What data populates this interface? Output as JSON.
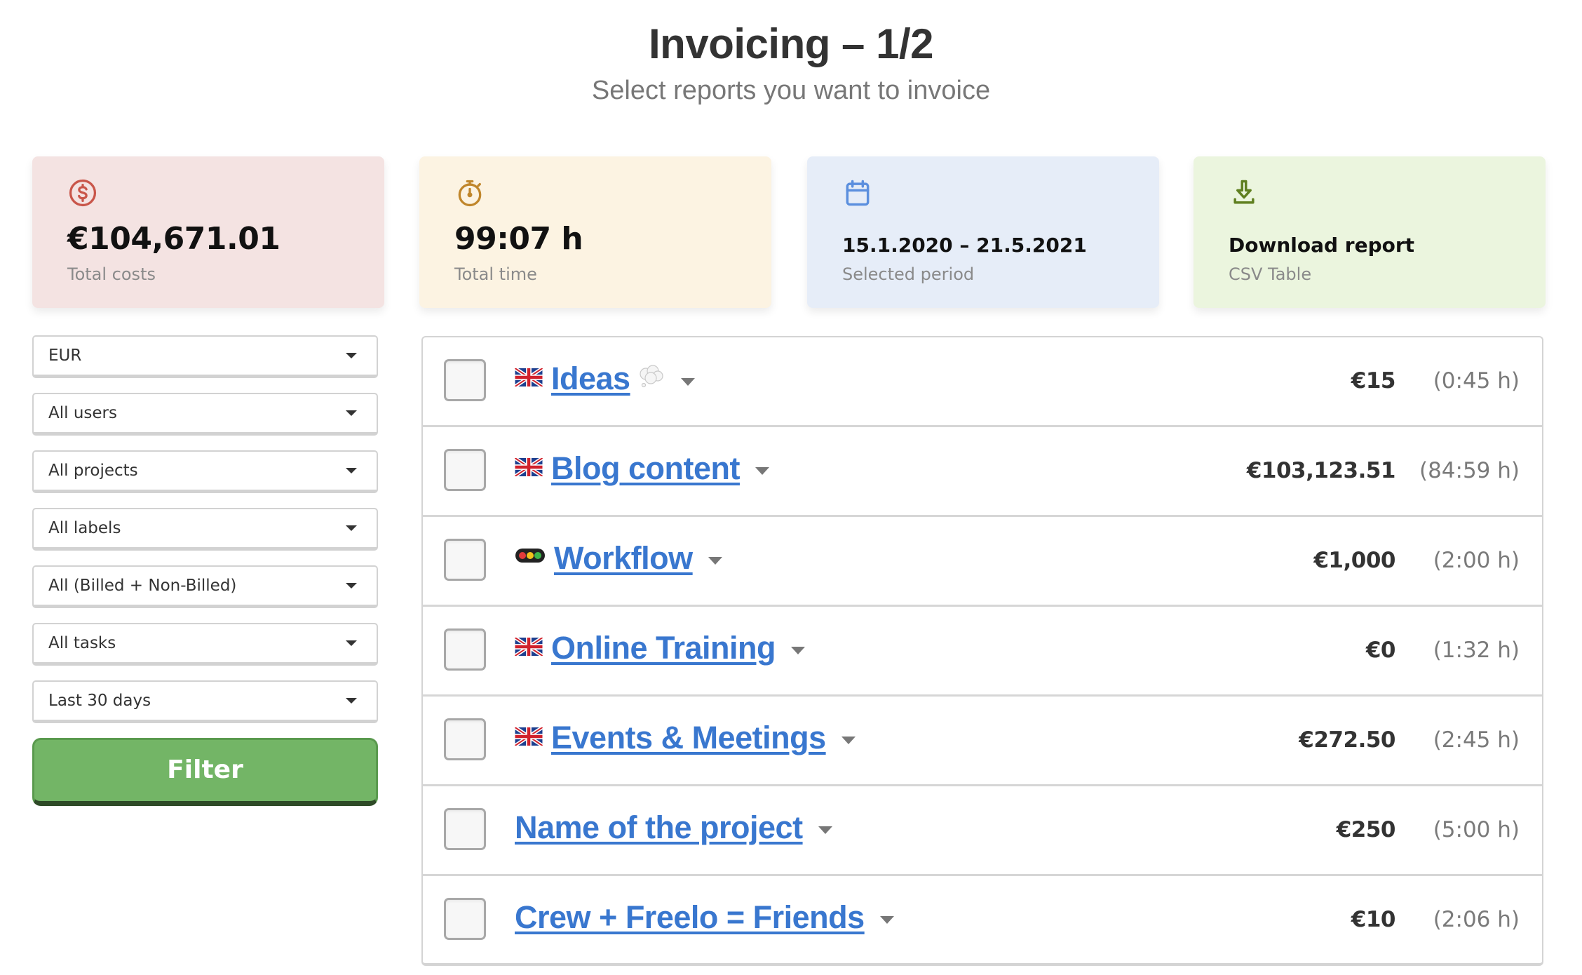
{
  "header": {
    "title": "Invoicing – 1/2",
    "subtitle": "Select reports you want to invoice"
  },
  "summary": {
    "costs": {
      "icon": "dollar-circle-icon",
      "value": "€104,671.01",
      "label": "Total costs",
      "color": "#c9564a",
      "background": "#f4e3e2"
    },
    "time": {
      "icon": "stopwatch-icon",
      "value": "99:07 h",
      "label": "Total time",
      "color": "#c0862b",
      "background": "#fcf3e2"
    },
    "period": {
      "icon": "calendar-icon",
      "value": "15.1.2020 – 21.5.2021",
      "label": "Selected period",
      "color": "#5b8fde",
      "background": "#e6edf8"
    },
    "download": {
      "icon": "download-icon",
      "value": "Download report",
      "label": "CSV Table",
      "color": "#5f7f1f",
      "background": "#ebf5de"
    }
  },
  "filters": {
    "selects": [
      {
        "name": "currency",
        "value": "EUR"
      },
      {
        "name": "users",
        "value": "All users"
      },
      {
        "name": "projects",
        "value": "All projects"
      },
      {
        "name": "labels",
        "value": "All labels"
      },
      {
        "name": "billing",
        "value": "All (Billed + Non-Billed)"
      },
      {
        "name": "tasks",
        "value": "All tasks"
      },
      {
        "name": "period",
        "value": "Last 30 days"
      }
    ],
    "button_label": "Filter",
    "button_color": "#73b566"
  },
  "reports": [
    {
      "prefix_icon": "uk-flag-icon",
      "name": "Ideas",
      "suffix_icon": "thought-bubble-icon",
      "amount": "€15",
      "duration": "(0:45 h)",
      "checked": false
    },
    {
      "prefix_icon": "uk-flag-icon",
      "name": "Blog content",
      "amount": "€103,123.51",
      "duration": "(84:59 h)",
      "checked": false
    },
    {
      "prefix_icon": "traffic-light-icon",
      "name": "Workflow",
      "amount": "€1,000",
      "duration": "(2:00 h)",
      "checked": false
    },
    {
      "prefix_icon": "uk-flag-icon",
      "name": "Online Training",
      "amount": "€0",
      "duration": "(1:32 h)",
      "checked": false
    },
    {
      "prefix_icon": "uk-flag-icon",
      "name": "Events & Meetings",
      "amount": "€272.50",
      "duration": "(2:45 h)",
      "checked": false
    },
    {
      "name": "Name of the project",
      "amount": "€250",
      "duration": "(5:00 h)",
      "checked": false
    },
    {
      "name": "Crew + Freelo = Friends",
      "amount": "€10",
      "duration": "(2:06 h)",
      "checked": false
    }
  ],
  "colors": {
    "link": "#3977cf",
    "text": "#333333",
    "muted": "#7a7a7a"
  }
}
